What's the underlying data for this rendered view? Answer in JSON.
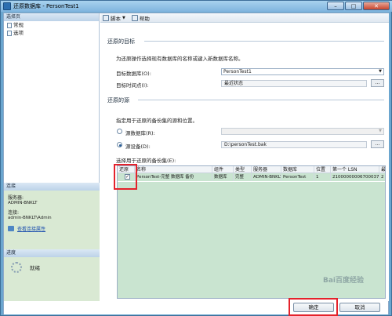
{
  "window": {
    "title": "还原数据库 - PersonTest1",
    "close_glyph": "✕"
  },
  "sidebar": {
    "header": "选择页",
    "pages": [
      {
        "label": "常规"
      },
      {
        "label": "选项"
      }
    ],
    "connection": {
      "title": "连接",
      "server_label": "服务器:",
      "server_value": "ADMIN-BNKLT",
      "conn_label": "连接:",
      "conn_value": "admin-BNKLT\\Admin",
      "link_text": "查看连接属性"
    },
    "progress": {
      "title": "进度",
      "status": "就绪"
    }
  },
  "toolbar": {
    "script_label": "脚本",
    "help_label": "帮助"
  },
  "target": {
    "group_title": "还原的目标",
    "hint": "为还原操作选择现有数据库的名称或键入新数据库名称。",
    "dest_db_label": "目标数据库(O):",
    "dest_db_value": "PersonTest1",
    "point_label": "目标时间点(I):",
    "point_value": "最近状态"
  },
  "source": {
    "group_title": "还原的源",
    "hint": "指定用于还原的备份集的源和位置。",
    "from_db_label": "源数据库(R):",
    "from_device_label": "源设备(D):",
    "device_value": "D:\\personTest.bak",
    "browse_label": "...",
    "sets_label": "选择用于还原的备份集(E):"
  },
  "backup_table": {
    "columns": [
      "还原",
      "名称",
      "组件",
      "类型",
      "服务器",
      "数据库",
      "位置",
      "第一个 LSN",
      "最"
    ],
    "rows": [
      {
        "restore": "✓",
        "name": "PersonTest-完整 数据库 备份",
        "component": "数据库",
        "type": "完整",
        "server": "ADMIN-BNKLT",
        "database": "PersonTest",
        "position": "1",
        "first_lsn": "21000000006700037",
        "last": "2"
      }
    ]
  },
  "buttons": {
    "ok": "确定",
    "cancel": "取消"
  },
  "watermark": "Bai百度经验",
  "colors": {
    "title_bar": "#7fb4de",
    "side_panel_green": "#d9e9d3",
    "selected_row": "#c9e4d0",
    "highlight": "#e4222b"
  }
}
